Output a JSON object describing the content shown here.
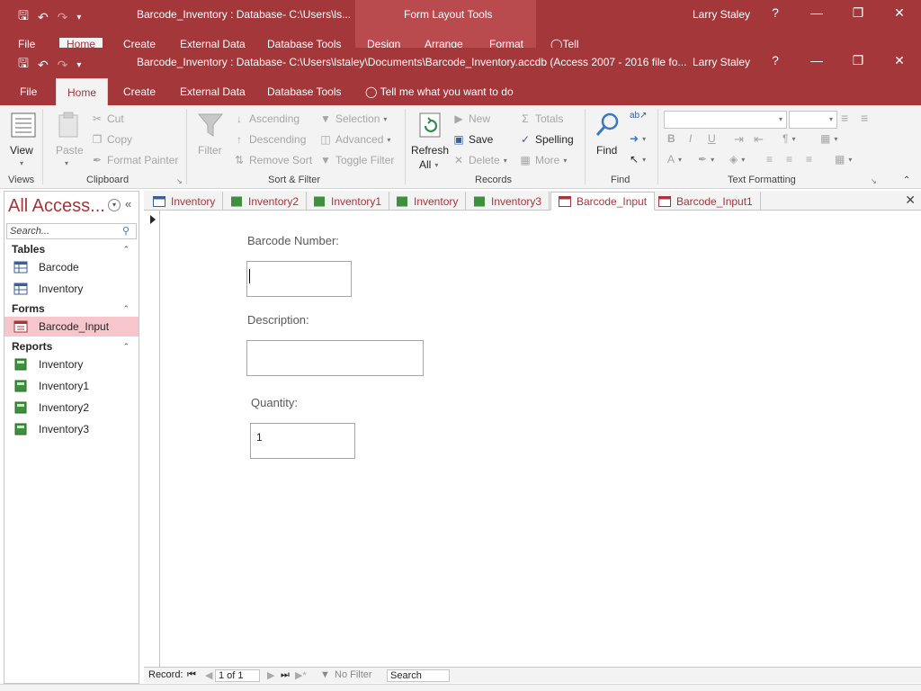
{
  "back_window": {
    "title": "Barcode_Inventory : Database- C:\\Users\\ls...",
    "context_tab": "Form Layout Tools",
    "user": "Larry Staley",
    "help": "?",
    "tabs": [
      "File",
      "Home",
      "Create",
      "External Data",
      "Database Tools",
      "Design",
      "Arrange",
      "Format"
    ],
    "tell_me": "Tell me what you want to do"
  },
  "window": {
    "title": "Barcode_Inventory : Database- C:\\Users\\lstaley\\Documents\\Barcode_Inventory.accdb (Access 2007 - 2016 file fo...",
    "user": "Larry Staley",
    "help": "?"
  },
  "ribbon_tabs": {
    "file": "File",
    "home": "Home",
    "create": "Create",
    "external": "External Data",
    "dbtools": "Database Tools",
    "tell_me": "Tell me what you want to do"
  },
  "ribbon": {
    "views": {
      "view": "View",
      "label": "Views"
    },
    "clipboard": {
      "paste": "Paste",
      "cut": "Cut",
      "copy": "Copy",
      "format_painter": "Format Painter",
      "label": "Clipboard"
    },
    "sort_filter": {
      "filter": "Filter",
      "ascending": "Ascending",
      "descending": "Descending",
      "remove_sort": "Remove Sort",
      "selection": "Selection",
      "advanced": "Advanced",
      "toggle_filter": "Toggle Filter",
      "label": "Sort & Filter"
    },
    "records": {
      "refresh": "Refresh",
      "refresh_all": "All",
      "new": "New",
      "save": "Save",
      "delete": "Delete",
      "totals": "Totals",
      "spelling": "Spelling",
      "more": "More",
      "label": "Records"
    },
    "find": {
      "find": "Find",
      "label": "Find"
    },
    "text_formatting": {
      "label": "Text Formatting",
      "bold": "B",
      "italic": "I",
      "underline": "U",
      "font_color": "A"
    }
  },
  "nav": {
    "header": "All Access...",
    "search_placeholder": "Search...",
    "categories": [
      {
        "name": "Tables",
        "items": [
          "Barcode",
          "Inventory"
        ]
      },
      {
        "name": "Forms",
        "items": [
          "Barcode_Input"
        ]
      },
      {
        "name": "Reports",
        "items": [
          "Inventory",
          "Inventory1",
          "Inventory2",
          "Inventory3"
        ]
      }
    ]
  },
  "doc_tabs": [
    "Inventory",
    "Inventory2",
    "Inventory1",
    "Inventory",
    "Inventory3",
    "Barcode_Input",
    "Barcode_Input1"
  ],
  "form": {
    "barcode_label": "Barcode Number:",
    "barcode_value": "",
    "description_label": "Description:",
    "description_value": "",
    "quantity_label": "Quantity:",
    "quantity_value": "1"
  },
  "record_nav": {
    "label": "Record:",
    "position": "1 of 1",
    "filter": "No Filter",
    "search": "Search"
  },
  "colors": {
    "accent": "#a4373a",
    "selected_nav": "#f6c6cc"
  }
}
